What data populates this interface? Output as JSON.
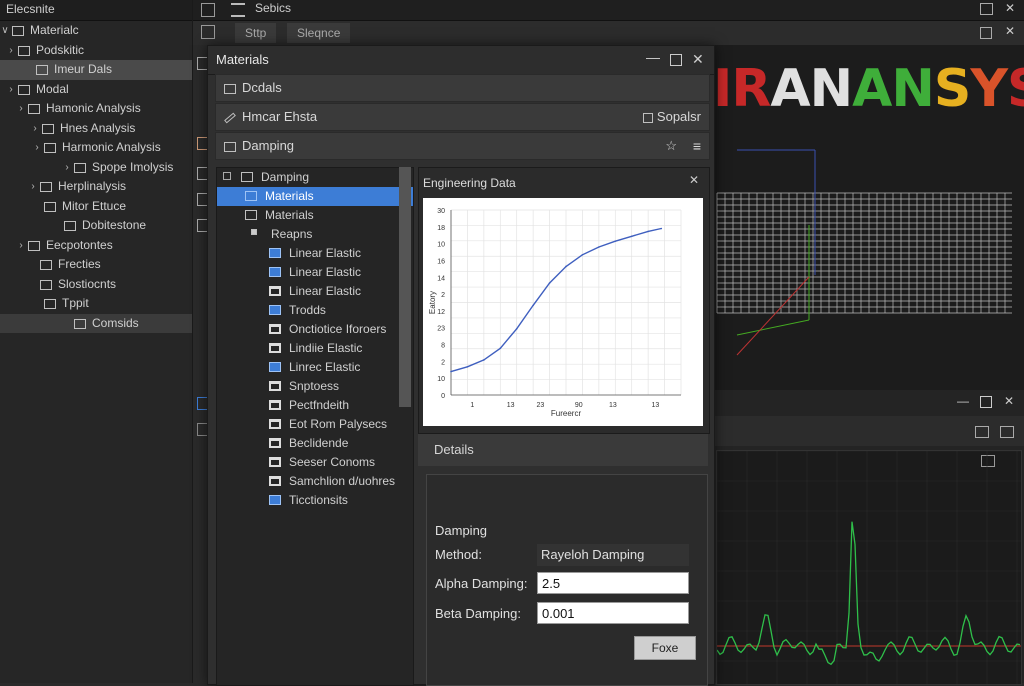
{
  "left_panel": {
    "title": "Elecsnite",
    "items": [
      {
        "label": "Materialc",
        "indent": 8,
        "arrow": "∨"
      },
      {
        "label": "Podskitic",
        "indent": 14,
        "arrow": "›"
      },
      {
        "label": "Imeur Dals",
        "indent": 32,
        "arrow": "",
        "selected": true
      },
      {
        "label": "Modal",
        "indent": 14,
        "arrow": "›"
      },
      {
        "label": "Hamonic Analysis",
        "indent": 24,
        "arrow": "›"
      },
      {
        "label": "Hnes Analysis",
        "indent": 38,
        "arrow": "›"
      },
      {
        "label": "Harmonic Analysis",
        "indent": 40,
        "arrow": "›"
      },
      {
        "label": "Spope Imolysis",
        "indent": 70,
        "arrow": "›"
      },
      {
        "label": "Herplinalysis",
        "indent": 36,
        "arrow": "›"
      },
      {
        "label": "Mitor Ettuce",
        "indent": 40,
        "arrow": ""
      },
      {
        "label": "Dobitestone",
        "indent": 60,
        "arrow": ""
      },
      {
        "label": "Eecpotontes",
        "indent": 24,
        "arrow": "›"
      },
      {
        "label": "Frecties",
        "indent": 36,
        "arrow": ""
      },
      {
        "label": "Slostiocnts",
        "indent": 36,
        "arrow": ""
      },
      {
        "label": "Tppit",
        "indent": 40,
        "arrow": ""
      },
      {
        "label": "Comsids",
        "indent": 70,
        "arrow": "",
        "selected2": true
      }
    ]
  },
  "top": {
    "title": "Sebics",
    "tab1": "Sttp",
    "tab2": "Sleqnce"
  },
  "logo": {
    "text": "IRANANSYS"
  },
  "dialog": {
    "title": "Materials",
    "section1": "Dcdals",
    "section2": "Hmcar Ehsta",
    "section2_right": "Sopalsr",
    "section3": "Damping",
    "tree": [
      {
        "label": "Damping",
        "indent": 6,
        "icon": "box"
      },
      {
        "label": "Materials",
        "indent": 28,
        "icon": "blue",
        "selected": true
      },
      {
        "label": "Materials",
        "indent": 28,
        "icon": "grid"
      },
      {
        "label": "Reapns",
        "indent": 34,
        "icon": "small"
      },
      {
        "label": "Linear Elastic",
        "indent": 52,
        "icon": "blue"
      },
      {
        "label": "Linear Elastic",
        "indent": 52,
        "icon": "blue"
      },
      {
        "label": "Linear Elastic",
        "indent": 52,
        "icon": "white"
      },
      {
        "label": "Trodds",
        "indent": 52,
        "icon": "blue"
      },
      {
        "label": "Onctiotice Iforoers",
        "indent": 52,
        "icon": "white"
      },
      {
        "label": "Lindiie Elastic",
        "indent": 52,
        "icon": "white"
      },
      {
        "label": "Linrec Elastic",
        "indent": 52,
        "icon": "blue"
      },
      {
        "label": "Snptoess",
        "indent": 52,
        "icon": "white"
      },
      {
        "label": "Pectfndeith",
        "indent": 52,
        "icon": "white"
      },
      {
        "label": "Eot Rom Palysecs",
        "indent": 52,
        "icon": "white"
      },
      {
        "label": "Beclidende",
        "indent": 52,
        "icon": "white"
      },
      {
        "label": "Seeser Conoms",
        "indent": 52,
        "icon": "white"
      },
      {
        "label": "Samchlion d/uohres",
        "indent": 52,
        "icon": "white"
      },
      {
        "label": "Ticctionsits",
        "indent": 52,
        "icon": "blue"
      }
    ],
    "eng_title": "Engineering Data",
    "details_title": "Details",
    "damping_group": "Damping",
    "method_label": "Method:",
    "method_value": "Rayeloh Damping",
    "alpha_label": "Alpha Damping:",
    "alpha_value": "2.5",
    "beta_label": "Beta Damping:",
    "beta_value": "0.001",
    "button": "Foxe"
  },
  "chart_data": {
    "type": "line",
    "ylabel": "Eatory",
    "xlabel": "Fureercr",
    "yticks": [
      "30",
      "18",
      "10",
      "16",
      "14",
      "2",
      "12",
      "23",
      "8",
      "2",
      "10",
      "0"
    ],
    "xticks": [
      "1",
      "13",
      "23",
      "90",
      "13",
      "13"
    ],
    "series": [
      {
        "values": [
          [
            0,
            2.4
          ],
          [
            0.5,
            2.9
          ],
          [
            1,
            3.6
          ],
          [
            1.5,
            4.8
          ],
          [
            2,
            6.8
          ],
          [
            2.5,
            9.2
          ],
          [
            3,
            11.5
          ],
          [
            3.5,
            13.2
          ],
          [
            4,
            14.4
          ],
          [
            4.5,
            15.2
          ],
          [
            5,
            15.8
          ],
          [
            5.5,
            16.3
          ],
          [
            6,
            16.8
          ],
          [
            6.4,
            17.1
          ]
        ]
      }
    ],
    "xlim": [
      0,
      7
    ],
    "ylim": [
      0,
      19
    ],
    "color": "#3f5fbf"
  },
  "colors": {
    "accent": "#3d7dd6",
    "wave": "#2fbf4a",
    "baseline": "#c0392b"
  }
}
